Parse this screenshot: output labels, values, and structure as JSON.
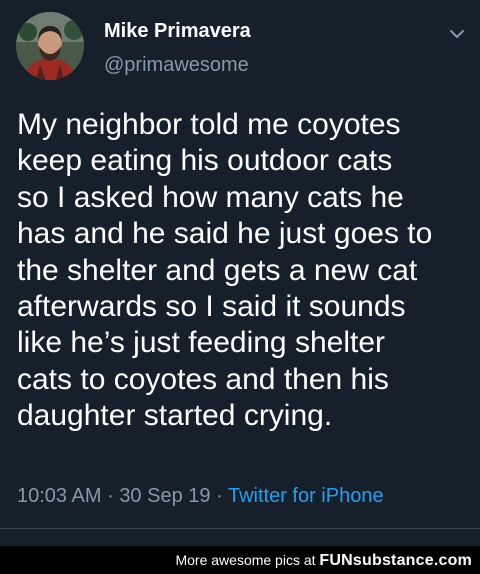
{
  "tweet": {
    "author_name": "Mike Primavera",
    "author_handle": "@primawesome",
    "menu_icon": "chevron-down-icon",
    "body_lines": [
      "My neighbor told me coyotes",
      "keep eating his outdoor cats",
      "so I asked how many cats he",
      "has and he said he just goes to",
      "the shelter and gets a new cat",
      "afterwards so I said it sounds",
      "like he’s just feeding shelter",
      "cats to coyotes and then his",
      "daughter started crying."
    ],
    "time": "10:03 AM",
    "separator": "·",
    "date": "30 Sep 19",
    "source": "Twitter for iPhone"
  },
  "watermark": {
    "prefix": "More awesome pics at ",
    "brand": "FUNsubstance.com"
  },
  "colors": {
    "background": "#15202b",
    "text": "#ffffff",
    "muted": "#8899a6",
    "link": "#1da1f2",
    "divider": "#38444d"
  }
}
